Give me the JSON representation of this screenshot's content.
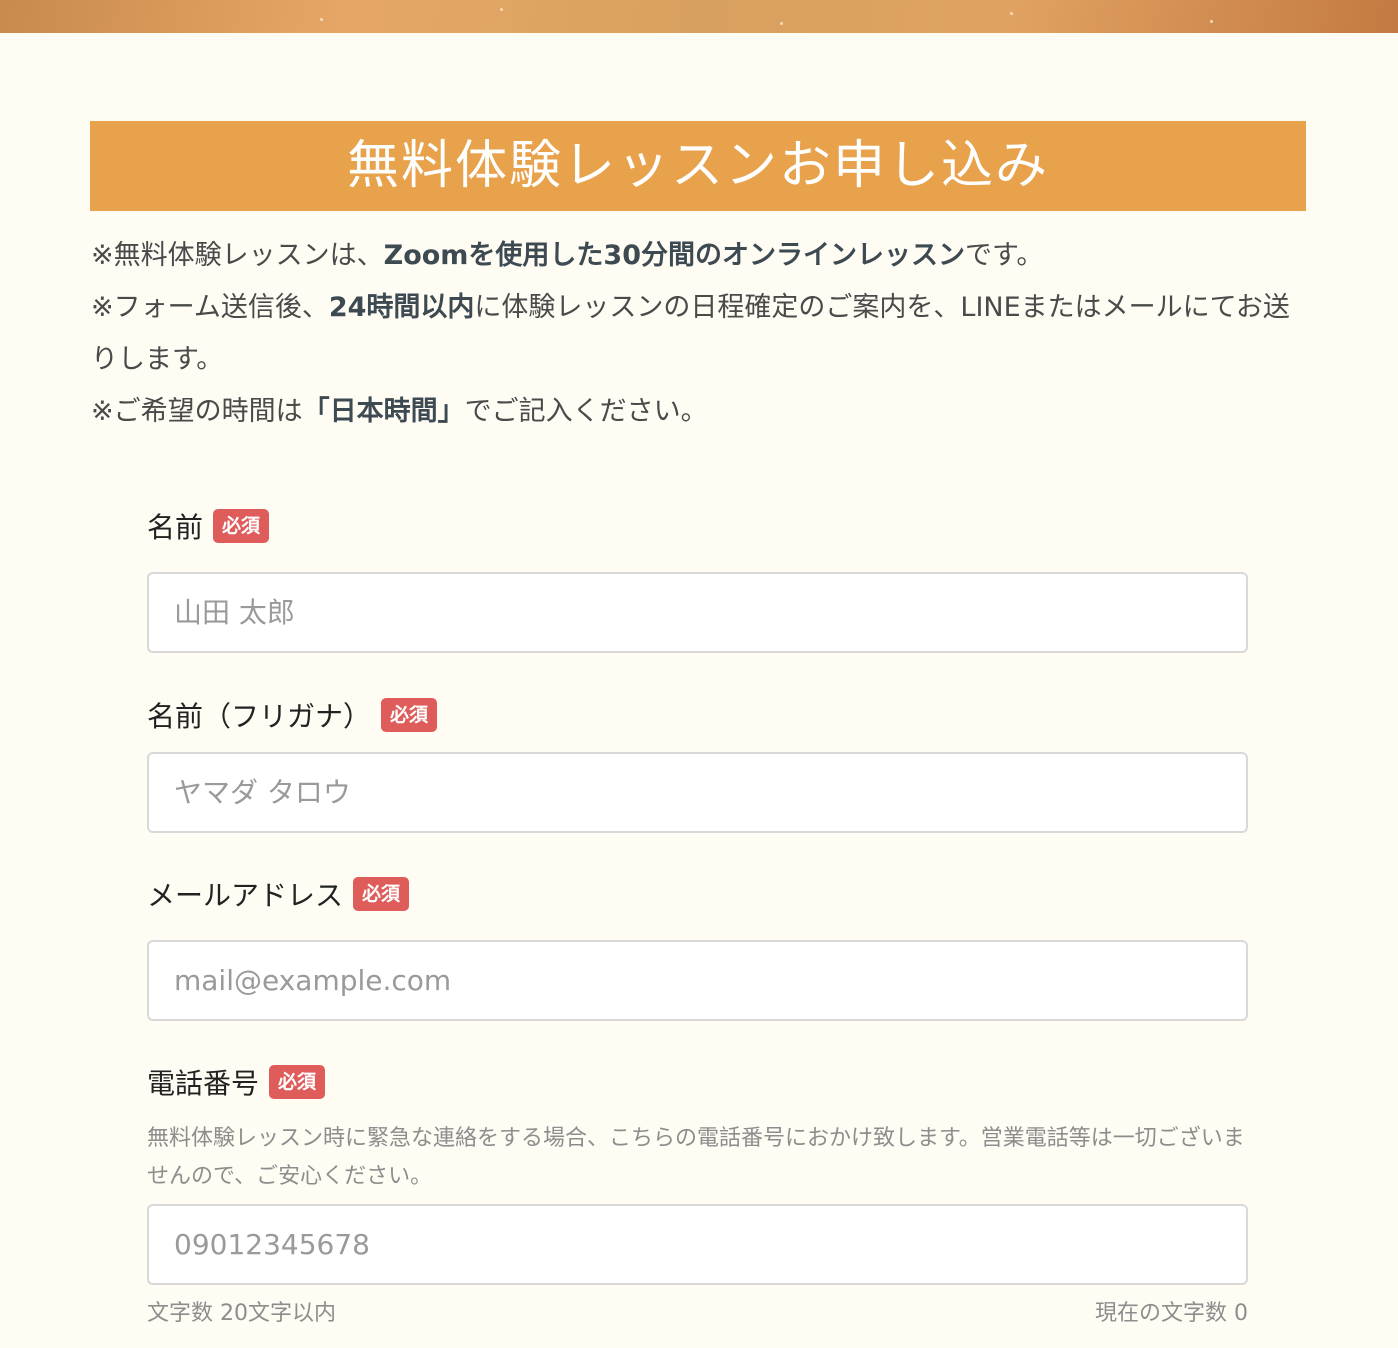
{
  "banner": {
    "title": "無料体験レッスンお申し込み"
  },
  "notes": {
    "line1": {
      "pre": "※無料体験レッスンは、",
      "bold": "Zoomを使用した30分間のオンラインレッスン",
      "post": "です。"
    },
    "line2": {
      "pre": "※フォーム送信後、",
      "bold": "24時間以内",
      "post": "に体験レッスンの日程確定のご案内を、LINEまたはメールにてお送りします。"
    },
    "line3": {
      "pre": "※ご希望の時間は",
      "bold": "「日本時間」",
      "post": "でご記入ください。"
    }
  },
  "required_badge": "必須",
  "form": {
    "name": {
      "label": "名前",
      "placeholder": "山田 太郎",
      "value": ""
    },
    "kana": {
      "label": "名前（フリガナ）",
      "placeholder": "ヤマダ タロウ",
      "value": ""
    },
    "email": {
      "label": "メールアドレス",
      "placeholder": "mail@example.com",
      "value": ""
    },
    "phone": {
      "label": "電話番号",
      "help": "無料体験レッスン時に緊急な連絡をする場合、こちらの電話番号におかけ致します。営業電話等は一切ございませんので、ご安心ください。",
      "placeholder": "09012345678",
      "value": "",
      "limit_text": "文字数 20文字以内",
      "count_text": "現在の文字数 0"
    }
  },
  "colors": {
    "banner": "#e9a24c",
    "badge": "#de5d5b",
    "page_bg": "#fffcf4"
  }
}
